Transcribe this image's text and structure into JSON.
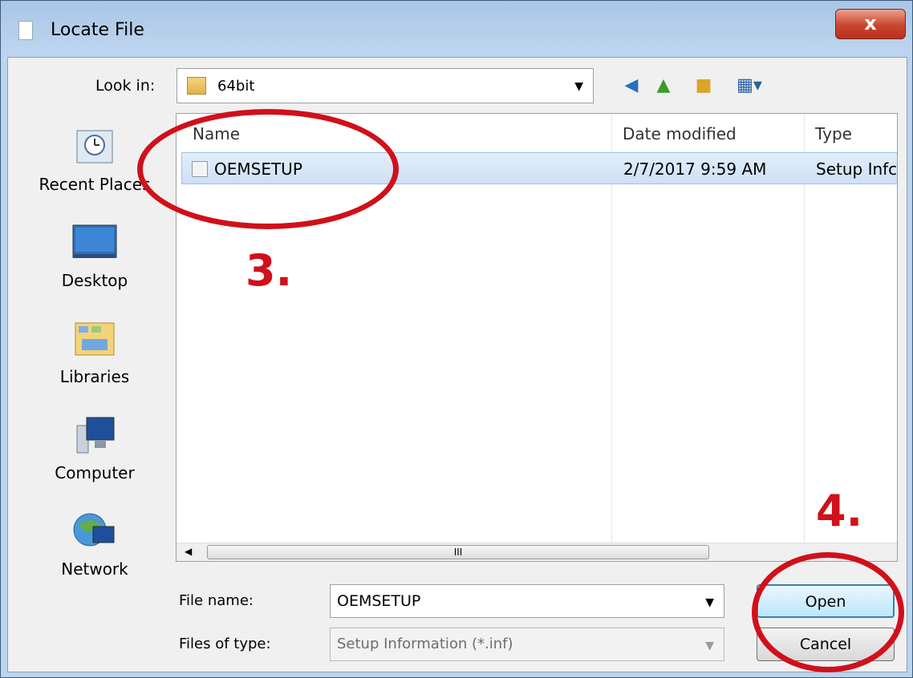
{
  "window": {
    "title": "Locate File",
    "close_label": "x"
  },
  "toolbar": {
    "look_in_label": "Look in:",
    "look_in_value": "64bit"
  },
  "places": [
    {
      "label": "Recent Places",
      "icon": "recent-places-icon"
    },
    {
      "label": "Desktop",
      "icon": "desktop-icon"
    },
    {
      "label": "Libraries",
      "icon": "libraries-icon"
    },
    {
      "label": "Computer",
      "icon": "computer-icon"
    },
    {
      "label": "Network",
      "icon": "network-icon"
    }
  ],
  "filelist": {
    "columns": [
      "Name",
      "Date modified",
      "Type"
    ],
    "rows": [
      {
        "name": "OEMSETUP",
        "date": "2/7/2017 9:59 AM",
        "type": "Setup Infc"
      }
    ],
    "scroll_thumb": "III"
  },
  "form": {
    "file_name_label": "File name:",
    "file_name_value": "OEMSETUP",
    "file_type_label": "Files of type:",
    "file_type_value": "Setup Information (*.inf)"
  },
  "buttons": {
    "open": "Open",
    "cancel": "Cancel"
  },
  "annotations": {
    "step3": "3.",
    "step4": "4."
  },
  "colors": {
    "annotation": "#d0101a",
    "selection": "#cde0f7"
  }
}
